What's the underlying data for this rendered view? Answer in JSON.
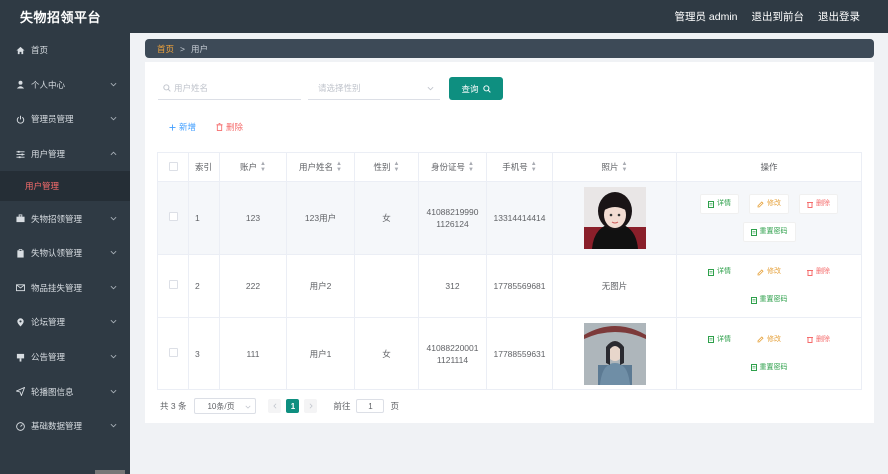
{
  "header": {
    "title": "失物招领平台",
    "admin_label": "管理员 admin",
    "back_label": "退出到前台",
    "logout_label": "退出登录"
  },
  "sidebar": {
    "items": [
      {
        "label": "首页",
        "icon": "home-icon"
      },
      {
        "label": "个人中心",
        "icon": "user-icon"
      },
      {
        "label": "管理员管理",
        "icon": "power-icon"
      },
      {
        "label": "用户管理",
        "icon": "sliders-icon"
      },
      {
        "label": "失物招领管理",
        "icon": "briefcase-icon"
      },
      {
        "label": "失物认领管理",
        "icon": "clipboard-icon"
      },
      {
        "label": "物品挂失管理",
        "icon": "mail-icon"
      },
      {
        "label": "论坛管理",
        "icon": "location-icon"
      },
      {
        "label": "公告管理",
        "icon": "announce-icon"
      },
      {
        "label": "轮播图信息",
        "icon": "send-icon"
      },
      {
        "label": "基础数据管理",
        "icon": "dashboard-icon"
      }
    ],
    "submenu_label": "用户管理"
  },
  "breadcrumb": {
    "home": "首页",
    "separator": ">",
    "current": "用户"
  },
  "search": {
    "name_placeholder": "用户姓名",
    "gender_placeholder": "请选择性别",
    "query_label": "查询"
  },
  "actions": {
    "add_label": "新增",
    "delete_label": "删除"
  },
  "table": {
    "headers": {
      "index": "索引",
      "account": "账户",
      "name": "用户姓名",
      "gender": "性别",
      "id_card": "身份证号",
      "phone": "手机号",
      "photo": "照片",
      "ops": "操作"
    },
    "rows": [
      {
        "index": "1",
        "account": "123",
        "name": "123用户",
        "gender": "女",
        "id_card": "410882199901126124",
        "phone": "13314414414",
        "photo": "portrait-a"
      },
      {
        "index": "2",
        "account": "222",
        "name": "用户2",
        "gender": "",
        "id_card": "312",
        "phone": "17785569681",
        "photo_text": "无图片"
      },
      {
        "index": "3",
        "account": "111",
        "name": "用户1",
        "gender": "女",
        "id_card": "410882200011121114",
        "phone": "17788559631",
        "photo": "portrait-b"
      }
    ],
    "op_labels": {
      "detail": "详情",
      "edit": "修改",
      "remove": "删除",
      "reset": "重置密码"
    }
  },
  "pagination": {
    "total": "共 3 条",
    "page_size": "10条/页",
    "current_page": "1",
    "goto_label": "前往",
    "goto_value": "1",
    "page_suffix": "页"
  },
  "colors": {
    "sidebar": "#2f3a44",
    "accent": "#0e8f80",
    "danger": "#f56c6c",
    "breadcrumb_home": "#f0a33a"
  }
}
